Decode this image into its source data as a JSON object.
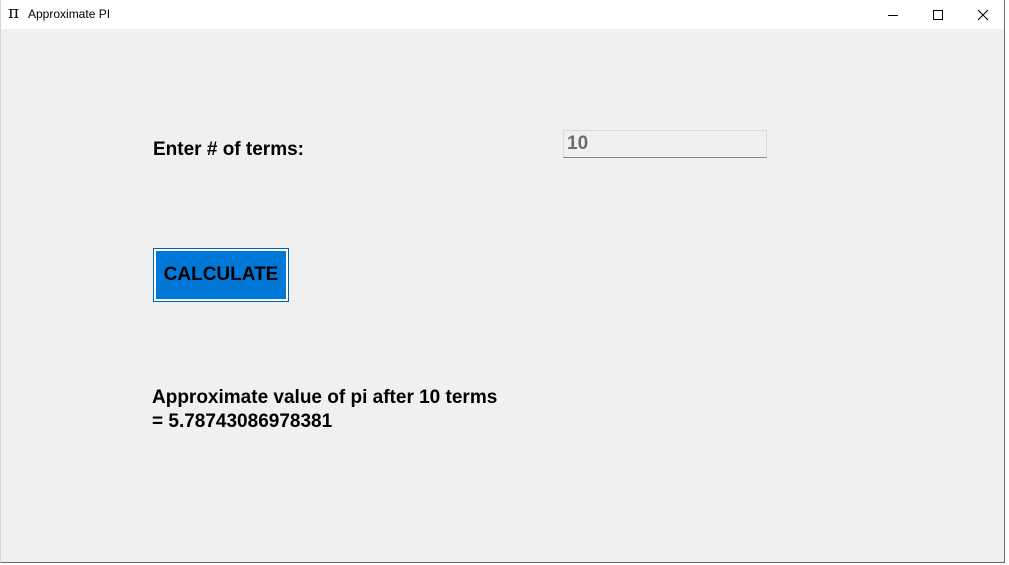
{
  "window": {
    "title": "Approximate PI",
    "icon": "pi-icon",
    "icon_glyph": "π"
  },
  "form": {
    "terms_label": "Enter # of terms:",
    "terms_value": "10",
    "calculate_label": "CALCULATE"
  },
  "result": {
    "line1": "Approximate value of pi after 10 terms",
    "line2": "= 5.78743086978381"
  },
  "colors": {
    "button_accent": "#0078d7",
    "background": "#f0f0f0"
  }
}
